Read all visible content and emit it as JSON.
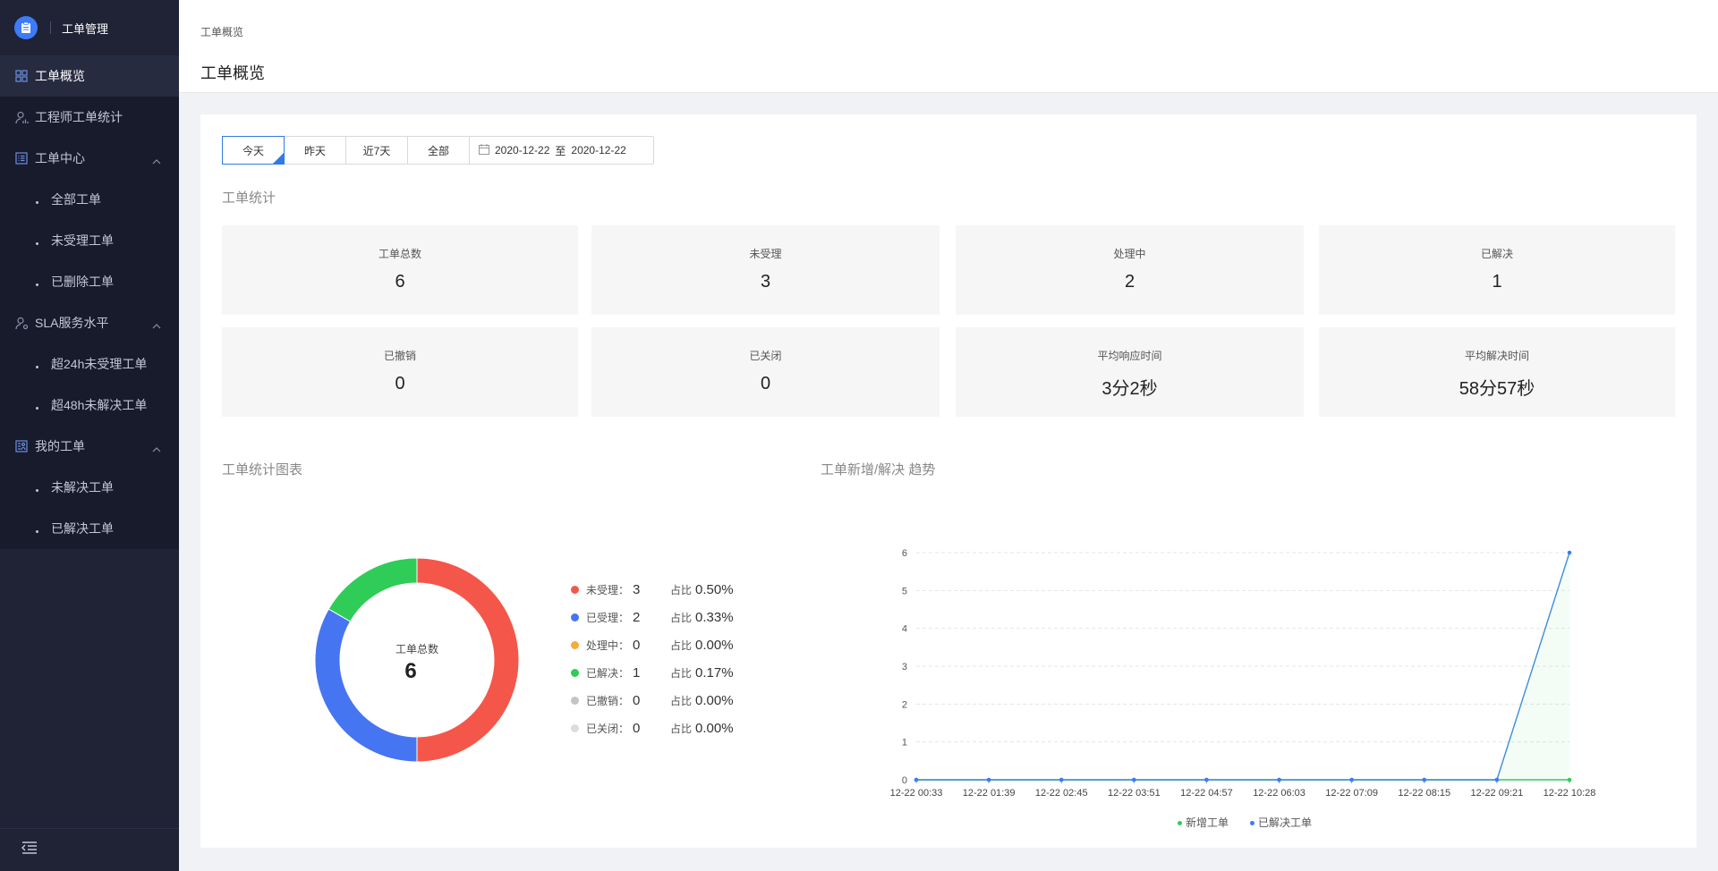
{
  "app": {
    "title": "工单管理"
  },
  "sidebar": {
    "items": [
      {
        "label": "工单概览",
        "icon": "grid-icon",
        "active": true
      },
      {
        "label": "工程师工单统计",
        "icon": "user-chart-icon"
      },
      {
        "label": "工单中心",
        "icon": "list-icon",
        "expanded": true,
        "children": [
          "全部工单",
          "未受理工单",
          "已删除工单"
        ]
      },
      {
        "label": "SLA服务水平",
        "icon": "user-gear-icon",
        "expanded": true,
        "children": [
          "超24h未受理工单",
          "超48h未解决工单"
        ]
      },
      {
        "label": "我的工单",
        "icon": "my-ticket-icon",
        "expanded": true,
        "children": [
          "未解决工单",
          "已解决工单"
        ]
      }
    ]
  },
  "header": {
    "breadcrumb": "工单概览",
    "title": "工单概览"
  },
  "filters": {
    "tabs": [
      "今天",
      "昨天",
      "近7天",
      "全部"
    ],
    "active_tab": "今天",
    "date_start": "2020-12-22",
    "date_sep": "至",
    "date_end": "2020-12-22"
  },
  "stats_title": "工单统计",
  "stats": [
    {
      "label": "工单总数",
      "value": "6"
    },
    {
      "label": "未受理",
      "value": "3"
    },
    {
      "label": "处理中",
      "value": "2"
    },
    {
      "label": "已解决",
      "value": "1"
    },
    {
      "label": "已撤销",
      "value": "0"
    },
    {
      "label": "已关闭",
      "value": "0"
    },
    {
      "label": "平均响应时间",
      "value": "3分2秒"
    },
    {
      "label": "平均解决时间",
      "value": "58分57秒"
    }
  ],
  "donut_title": "工单统计图表",
  "trend_title": "工单新增/解决 趋势",
  "chart_data": [
    {
      "type": "pie",
      "donut": true,
      "center_label": "工单总数",
      "center_value": "6",
      "pct_label": "占比",
      "slices": [
        {
          "name": "未受理：",
          "value": 3,
          "pct": "0.50%",
          "color": "#f5564a"
        },
        {
          "name": "已受理：",
          "value": 2,
          "pct": "0.33%",
          "color": "#4675f1"
        },
        {
          "name": "处理中：",
          "value": 0,
          "pct": "0.00%",
          "color": "#f6ab3b"
        },
        {
          "name": "已解决：",
          "value": 1,
          "pct": "0.17%",
          "color": "#2fcc58"
        },
        {
          "name": "已撤销：",
          "value": 0,
          "pct": "0.00%",
          "color": "#c4c4c4"
        },
        {
          "name": "已关闭：",
          "value": 0,
          "pct": "0.00%",
          "color": "#dcdcdc"
        }
      ]
    },
    {
      "type": "line",
      "x": [
        "12-22 00:33",
        "12-22 01:39",
        "12-22 02:45",
        "12-22 03:51",
        "12-22 04:57",
        "12-22 06:03",
        "12-22 07:09",
        "12-22 08:15",
        "12-22 09:21",
        "12-22 10:28"
      ],
      "ylim": [
        0,
        6
      ],
      "yticks": [
        0,
        1,
        2,
        3,
        4,
        5,
        6
      ],
      "grid": true,
      "legend": "bottom",
      "series": [
        {
          "name": "新增工单",
          "color": "#2fcc58",
          "values": [
            0,
            0,
            0,
            0,
            0,
            0,
            0,
            0,
            0,
            0
          ]
        },
        {
          "name": "已解决工单",
          "color": "#3d7bf7",
          "values": [
            0,
            0,
            0,
            0,
            0,
            0,
            0,
            0,
            0,
            6
          ]
        }
      ]
    }
  ]
}
